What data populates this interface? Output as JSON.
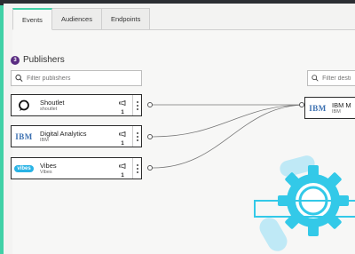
{
  "tabs": [
    {
      "label": "Events",
      "active": true
    },
    {
      "label": "Audiences",
      "active": false
    },
    {
      "label": "Endpoints",
      "active": false
    }
  ],
  "publishers": {
    "count": "3",
    "title": "Publishers",
    "search_placeholder": "Filter publishers",
    "items": [
      {
        "name": "Shoutlet",
        "sub": "shoutlet",
        "count": "1",
        "logo": "shoutlet-logo"
      },
      {
        "name": "Digital Analytics",
        "sub": "IBM",
        "count": "1",
        "logo": "ibm-logo",
        "logo_text": "IBM"
      },
      {
        "name": "Vibes",
        "sub": "Vibes",
        "count": "1",
        "logo": "vibes-logo",
        "logo_text": "vibes"
      }
    ]
  },
  "destinations": {
    "search_placeholder": "Filter desti",
    "items": [
      {
        "name": "IBM M",
        "sub": "IBM",
        "logo": "ibm-logo",
        "logo_text": "IBM"
      }
    ]
  },
  "colors": {
    "accent": "#41d1a7",
    "badge": "#5a2d82",
    "gear": "#33c9e8",
    "ibm_blue": "#3a6fb0"
  }
}
